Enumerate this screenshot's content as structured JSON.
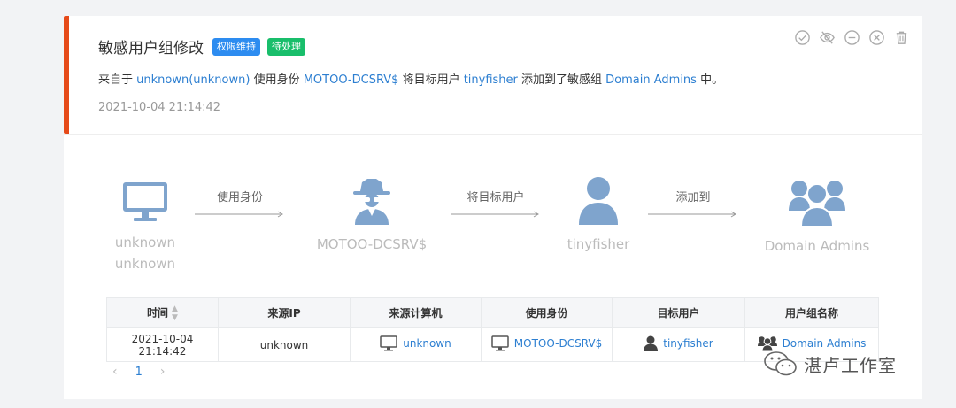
{
  "alert": {
    "title": "敏感用户组修改",
    "tags": [
      {
        "label": "权限维持",
        "color": "#2d8cf0"
      },
      {
        "label": "待处理",
        "color": "#19be6b"
      }
    ],
    "desc": {
      "p1": "来自于 ",
      "source_host": "unknown(unknown)",
      "p2": " 使用身份 ",
      "identity": "MOTOO-DCSRV$",
      "p3": " 将目标用户 ",
      "target_user": "tinyfisher",
      "p4": " 添加到了敏感组 ",
      "group": "Domain Admins",
      "p5": " 中。"
    },
    "timestamp": "2021-10-04 21:14:42",
    "accent_color": "#e64a19",
    "link_color": "#2d7fd1"
  },
  "flow": {
    "nodes": [
      {
        "icon": "computer-icon",
        "line1": "unknown",
        "line2": "unknown"
      },
      {
        "icon": "spy-icon",
        "line1": "MOTOO-DCSRV$"
      },
      {
        "icon": "user-icon",
        "line1": "tinyfisher"
      },
      {
        "icon": "group-icon",
        "line1": "Domain Admins"
      }
    ],
    "arrows": [
      "使用身份",
      "将目标用户",
      "添加到"
    ]
  },
  "table": {
    "headers": [
      "时间",
      "来源IP",
      "来源计算机",
      "使用身份",
      "目标用户",
      "用户组名称"
    ],
    "row": {
      "time": "2021-10-04 21:14:42",
      "ip": "unknown",
      "computer": "unknown",
      "identity": "MOTOO-DCSRV$",
      "target": "tinyfisher",
      "group": "Domain Admins"
    }
  },
  "pager": {
    "prev": "‹",
    "page": "1",
    "next": "›"
  },
  "watermark": "湛卢工作室"
}
